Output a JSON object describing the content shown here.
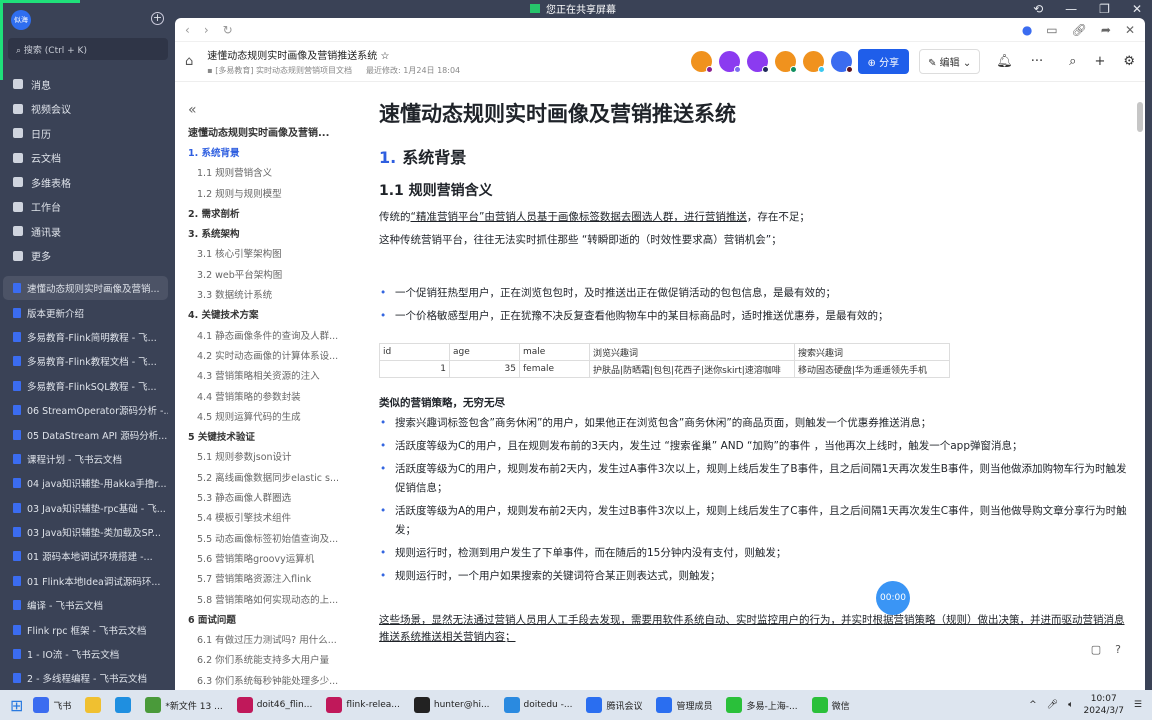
{
  "share_bar": "您正在共享屏幕",
  "sidebar": {
    "avatar": "似海",
    "search": "搜索 (Ctrl + K)",
    "nav": [
      "消息",
      "视频会议",
      "日历",
      "云文档",
      "多维表格",
      "工作台",
      "通讯录",
      "更多"
    ],
    "docs": [
      "速懂动态规则实时画像及营销...",
      "版本更新介绍",
      "多易教育-Flink简明教程 - 飞...",
      "多易教育-Flink教程文档 - 飞...",
      "多易教育-FlinkSQL教程 - 飞...",
      "06 StreamOperator源码分析 -...",
      "05 DataStream API 源码分析...",
      "课程计划 - 飞书云文档",
      "04 java知识辅垫-用akka手撸r...",
      "03 Java知识辅垫-rpc基础 - 飞...",
      "03 Java知识辅垫-类加载及SP...",
      "01 源码本地调试环境搭建 -...",
      "01 Flink本地Idea调试源码环...",
      "编译 - 飞书云文档",
      "Flink rpc 框架 - 飞书云文档",
      "1 - IO流 - 飞书云文档",
      "2 - 多线程编程 - 飞书云文档"
    ]
  },
  "header": {
    "title": "速懂动态规则实时画像及营销推送系统",
    "folder": "[多易教育] 实时动态规则营销项目文档",
    "modified": "最近修改: 1月24日 18:04",
    "share": "分享",
    "edit": "编辑",
    "avatars": [
      {
        "c": "#f0921e",
        "d": "#8a1f8f"
      },
      {
        "c": "#8b3bf0",
        "d": "#7b6cf0"
      },
      {
        "c": "#8b3bf0",
        "d": "#1f2a5a"
      },
      {
        "c": "#f0921e",
        "d": "#0f8f5f"
      },
      {
        "c": "#f0921e",
        "d": "#3ac8f0"
      },
      {
        "c": "#3b6cf0",
        "d": "#5a0f1f"
      }
    ]
  },
  "outline": {
    "title": "速懂动态规则实时画像及营销...",
    "items": [
      {
        "t": "1. 系统背景",
        "h": true,
        "cur": true
      },
      {
        "t": "1.1 规则营销含义"
      },
      {
        "t": "1.2 规则与规则模型"
      },
      {
        "t": "2. 需求剖析",
        "h": true
      },
      {
        "t": "3. 系统架构",
        "h": true
      },
      {
        "t": "3.1 核心引擎架构图"
      },
      {
        "t": "3.2 web平台架构图"
      },
      {
        "t": "3.3 数据统计系统"
      },
      {
        "t": "4. 关键技术方案",
        "h": true
      },
      {
        "t": "4.1 静态画像条件的查询及人群..."
      },
      {
        "t": "4.2 实时动态画像的计算体系设..."
      },
      {
        "t": "4.3 营销策略相关资源的注入"
      },
      {
        "t": "4.4 营销策略的参数封装"
      },
      {
        "t": "4.5 规则运算代码的生成"
      },
      {
        "t": "5 关键技术验证",
        "h": true
      },
      {
        "t": "5.1 规则参数json设计"
      },
      {
        "t": "5.2 离线画像数据同步elastic s..."
      },
      {
        "t": "5.3 静态画像人群圈选"
      },
      {
        "t": "5.4 模板引擎技术组件"
      },
      {
        "t": "5.5 动态画像标签初始值查询及..."
      },
      {
        "t": "5.6 营销策略groovy运算机"
      },
      {
        "t": "5.7 营销策略资源注入flink"
      },
      {
        "t": "5.8 营销策略如何实现动态的上..."
      },
      {
        "t": "6 面试问题",
        "h": true
      },
      {
        "t": "6.1 有做过压力测试吗? 用什么..."
      },
      {
        "t": "6.2 你们系统能支持多大用户量"
      },
      {
        "t": "6.3 你们系统每秒钟能处理多少..."
      }
    ]
  },
  "doc": {
    "h1": "速懂动态规则实时画像及营销推送系统",
    "h2_num": "1.",
    "h2": "系统背景",
    "h3": "1.1 规则营销含义",
    "p1_a": "传统的",
    "p1_u": "“精准营销平台”由营销人员基于画像标签数据去圈选人群，进行营销推送",
    "p1_b": "，存在不足；",
    "p2": "这种传统营销平台，往往无法实时抓住那些 “转瞬即逝的（时效性要求高）营销机会”；",
    "bullets1": [
      "一个促销狂热型用户，正在浏览包包时，及时推送出正在做促销活动的包包信息，是最有效的；",
      "一个价格敏感型用户，正在犹豫不决反复查看他购物车中的某目标商品时，适时推送优惠券，是最有效的；"
    ],
    "table": {
      "headers": [
        "id",
        "age",
        "male",
        "浏览兴趣词",
        "搜索兴趣词"
      ],
      "rows": [
        [
          "1",
          "35",
          "female",
          "护肤品|防晒霜|包包|花西子|迷你skirt|速溶咖啡",
          "移动固态硬盘|华为遥遥领先手机"
        ]
      ]
    },
    "strong": "类似的营销策略，无穷无尽",
    "bullets2": [
      "搜索兴趣词标签包含”商务休闲”的用户，如果他正在浏览包含”商务休闲”的商品页面，则触发一个优惠券推送消息；",
      "活跃度等级为C的用户，且在规则发布前的3天内，发生过 “搜索雀巢” AND “加购”的事件 ，当他再次上线时，触发一个app弹窗消息；",
      "活跃度等级为C的用户，规则发布前2天内，发生过A事件3次以上，规则上线后发生了B事件，且之后间隔1天再次发生B事件，则当他做添加购物车行为时触发促销信息；",
      "活跃度等级为A的用户，规则发布前2天内，发生过B事件3次以上，规则上线后发生了C事件，且之后间隔1天再次发生C事件，则当他做导购文章分享行为时触发；",
      "规则运行时，检测到用户发生了下单事件，而在随后的15分钟内没有支付，则触发；",
      "规则运行时，一个用户如果搜索的关键词符合某正则表达式，则触发；"
    ],
    "p3": "这些场景，显然无法通过营销人员用人工手段去发现，需要用软件系统自动、实时监控用户的行为，并实时根据营销策略（规则）做出决策，并进而驱动营销消息推送系统推送相关营销内容；"
  },
  "timer": "00:00",
  "taskbar": {
    "apps": [
      {
        "l": "飞书",
        "c": "#3b6cf0"
      },
      {
        "l": "",
        "c": "#f0c030"
      },
      {
        "l": "",
        "c": "#1f8fe0"
      },
      {
        "l": "*新文件 13 ...",
        "c": "#4a9a3a"
      },
      {
        "l": "doit46_flin...",
        "c": "#c0185a"
      },
      {
        "l": "flink-relea...",
        "c": "#c0185a"
      },
      {
        "l": "hunter@hi...",
        "c": "#222"
      },
      {
        "l": "doitedu -...",
        "c": "#2a8ae0"
      },
      {
        "l": "腾讯会议",
        "c": "#2a6ef0"
      },
      {
        "l": "管理成员",
        "c": "#2a6ef0"
      },
      {
        "l": "多易-上海-...",
        "c": "#2ac03a"
      },
      {
        "l": "微信",
        "c": "#2ac03a"
      }
    ],
    "time": "10:07",
    "date": "2024/3/7"
  }
}
